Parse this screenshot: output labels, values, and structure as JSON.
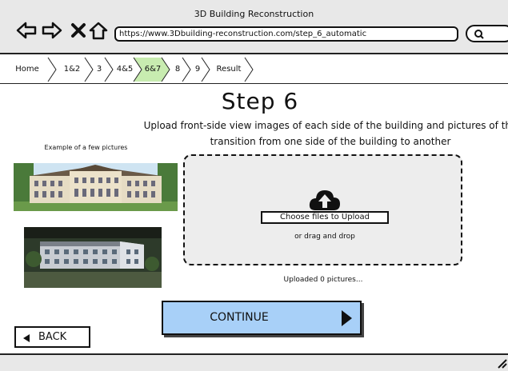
{
  "window": {
    "title": "3D Building Reconstruction",
    "url": "https://www.3Dbuilding-reconstruction.com/step_6_automatic"
  },
  "breadcrumb": {
    "items": [
      "Home",
      "1&2",
      "3",
      "4&5",
      "6&7",
      "8",
      "9",
      "Result"
    ],
    "active_index": 4,
    "active_color": "#c8ecb0"
  },
  "main": {
    "step_title": "Step 6",
    "instructions": "Upload front-side view images of each side of the building and pictures of the transition from one side of the building to another",
    "example_label": "Example of a few pictures",
    "dropzone": {
      "choose_button": "Choose files to Upload",
      "drag_text": "or drag and drop",
      "icon": "cloud-upload-icon"
    },
    "uploaded_status": "Uploaded 0 pictures...",
    "continue_label": "CONTINUE",
    "back_label": "BACK"
  },
  "colors": {
    "continue_bg": "#a8d0f8",
    "dropzone_bg": "#ededed",
    "chrome_bg": "#e8e8e8"
  }
}
